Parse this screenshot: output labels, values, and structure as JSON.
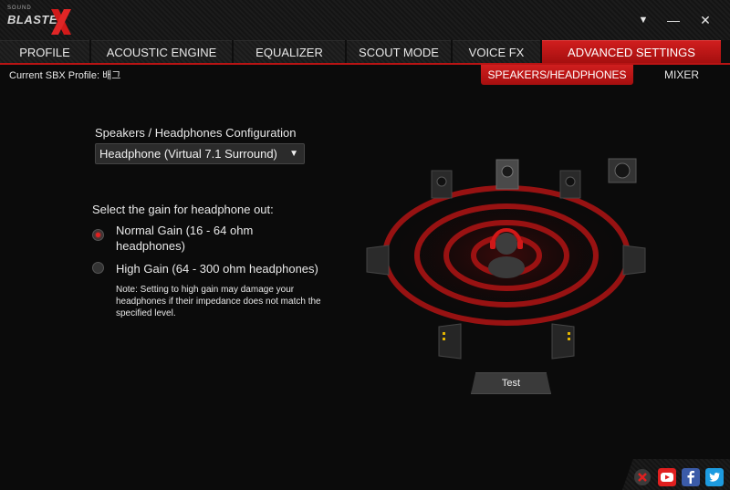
{
  "app": {
    "logo_small": "SOUND",
    "logo_word": "BLASTER"
  },
  "window": {
    "dropdown_glyph": "▼",
    "minimize_glyph": "—",
    "close_glyph": "✕"
  },
  "tabs": [
    {
      "label": "PROFILE"
    },
    {
      "label": "ACOUSTIC ENGINE"
    },
    {
      "label": "EQUALIZER"
    },
    {
      "label": "SCOUT MODE"
    },
    {
      "label": "VOICE FX"
    },
    {
      "label": "ADVANCED SETTINGS"
    }
  ],
  "active_tab": "ADVANCED SETTINGS",
  "profile_label": "Current SBX Profile: 배그",
  "subtabs": [
    {
      "label": "SPEAKERS/HEADPHONES"
    },
    {
      "label": "MIXER"
    }
  ],
  "config": {
    "label": "Speakers / Headphones Configuration",
    "selected": "Headphone (Virtual 7.1 Surround)",
    "caret": "▼"
  },
  "gain": {
    "label": "Select the gain for headphone out:",
    "options": [
      {
        "line1": "Normal Gain (16 - 64 ohm",
        "line2": "headphones)",
        "selected": true
      },
      {
        "line1": "High Gain (64 - 300 ohm headphones)",
        "selected": false
      }
    ],
    "note": "Note: Setting to high gain may damage your headphones if their impedance does not match the specified level."
  },
  "test_button": "Test",
  "colors": {
    "accent": "#c8161a",
    "background": "#0b0b0b",
    "panel": "#2b2b2b"
  },
  "social": [
    "creative-icon",
    "youtube-icon",
    "facebook-icon",
    "twitter-icon"
  ]
}
